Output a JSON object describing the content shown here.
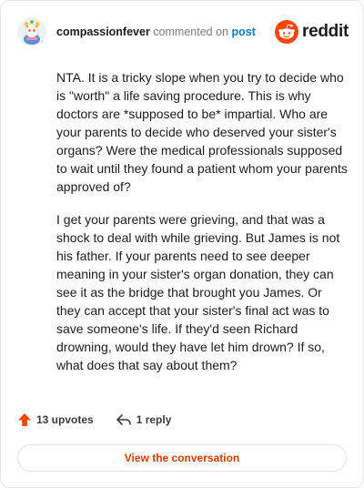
{
  "header": {
    "username": "compassionfever",
    "action_text": " commented on ",
    "post_link": "post",
    "brand_name": "reddit"
  },
  "comment": {
    "paragraphs": [
      "NTA. It is a tricky slope when you try to decide who is \"worth\" a life saving procedure. This is why doctors are *supposed to be* impartial. Who are your parents to decide who deserved your sister's organs? Were the medical professionals supposed to wait until they found a patient whom your parents approved of?",
      "I get your parents were grieving, and that was a shock to deal with while grieving. But James is not his father. If your parents need to see deeper meaning in your sister's organ donation, they can see it as the bridge that brought you James. Or they can accept that your sister's final act was to save someone's life. If they'd seen Richard drowning, would they have let him drown? If so, what does that say about them?"
    ]
  },
  "footer": {
    "upvotes": "13 upvotes",
    "replies": "1 reply",
    "view_button": "View the conversation"
  },
  "colors": {
    "brand_orange": "#ff4500",
    "upvote_orange": "#ff4500",
    "link_blue": "#0079d3",
    "button_text": "#d93a00"
  },
  "icons": {
    "avatar": "snoo-avatar",
    "brand": "reddit-logo-icon",
    "upvote": "upvote-arrow-icon",
    "reply": "reply-arrow-icon"
  }
}
